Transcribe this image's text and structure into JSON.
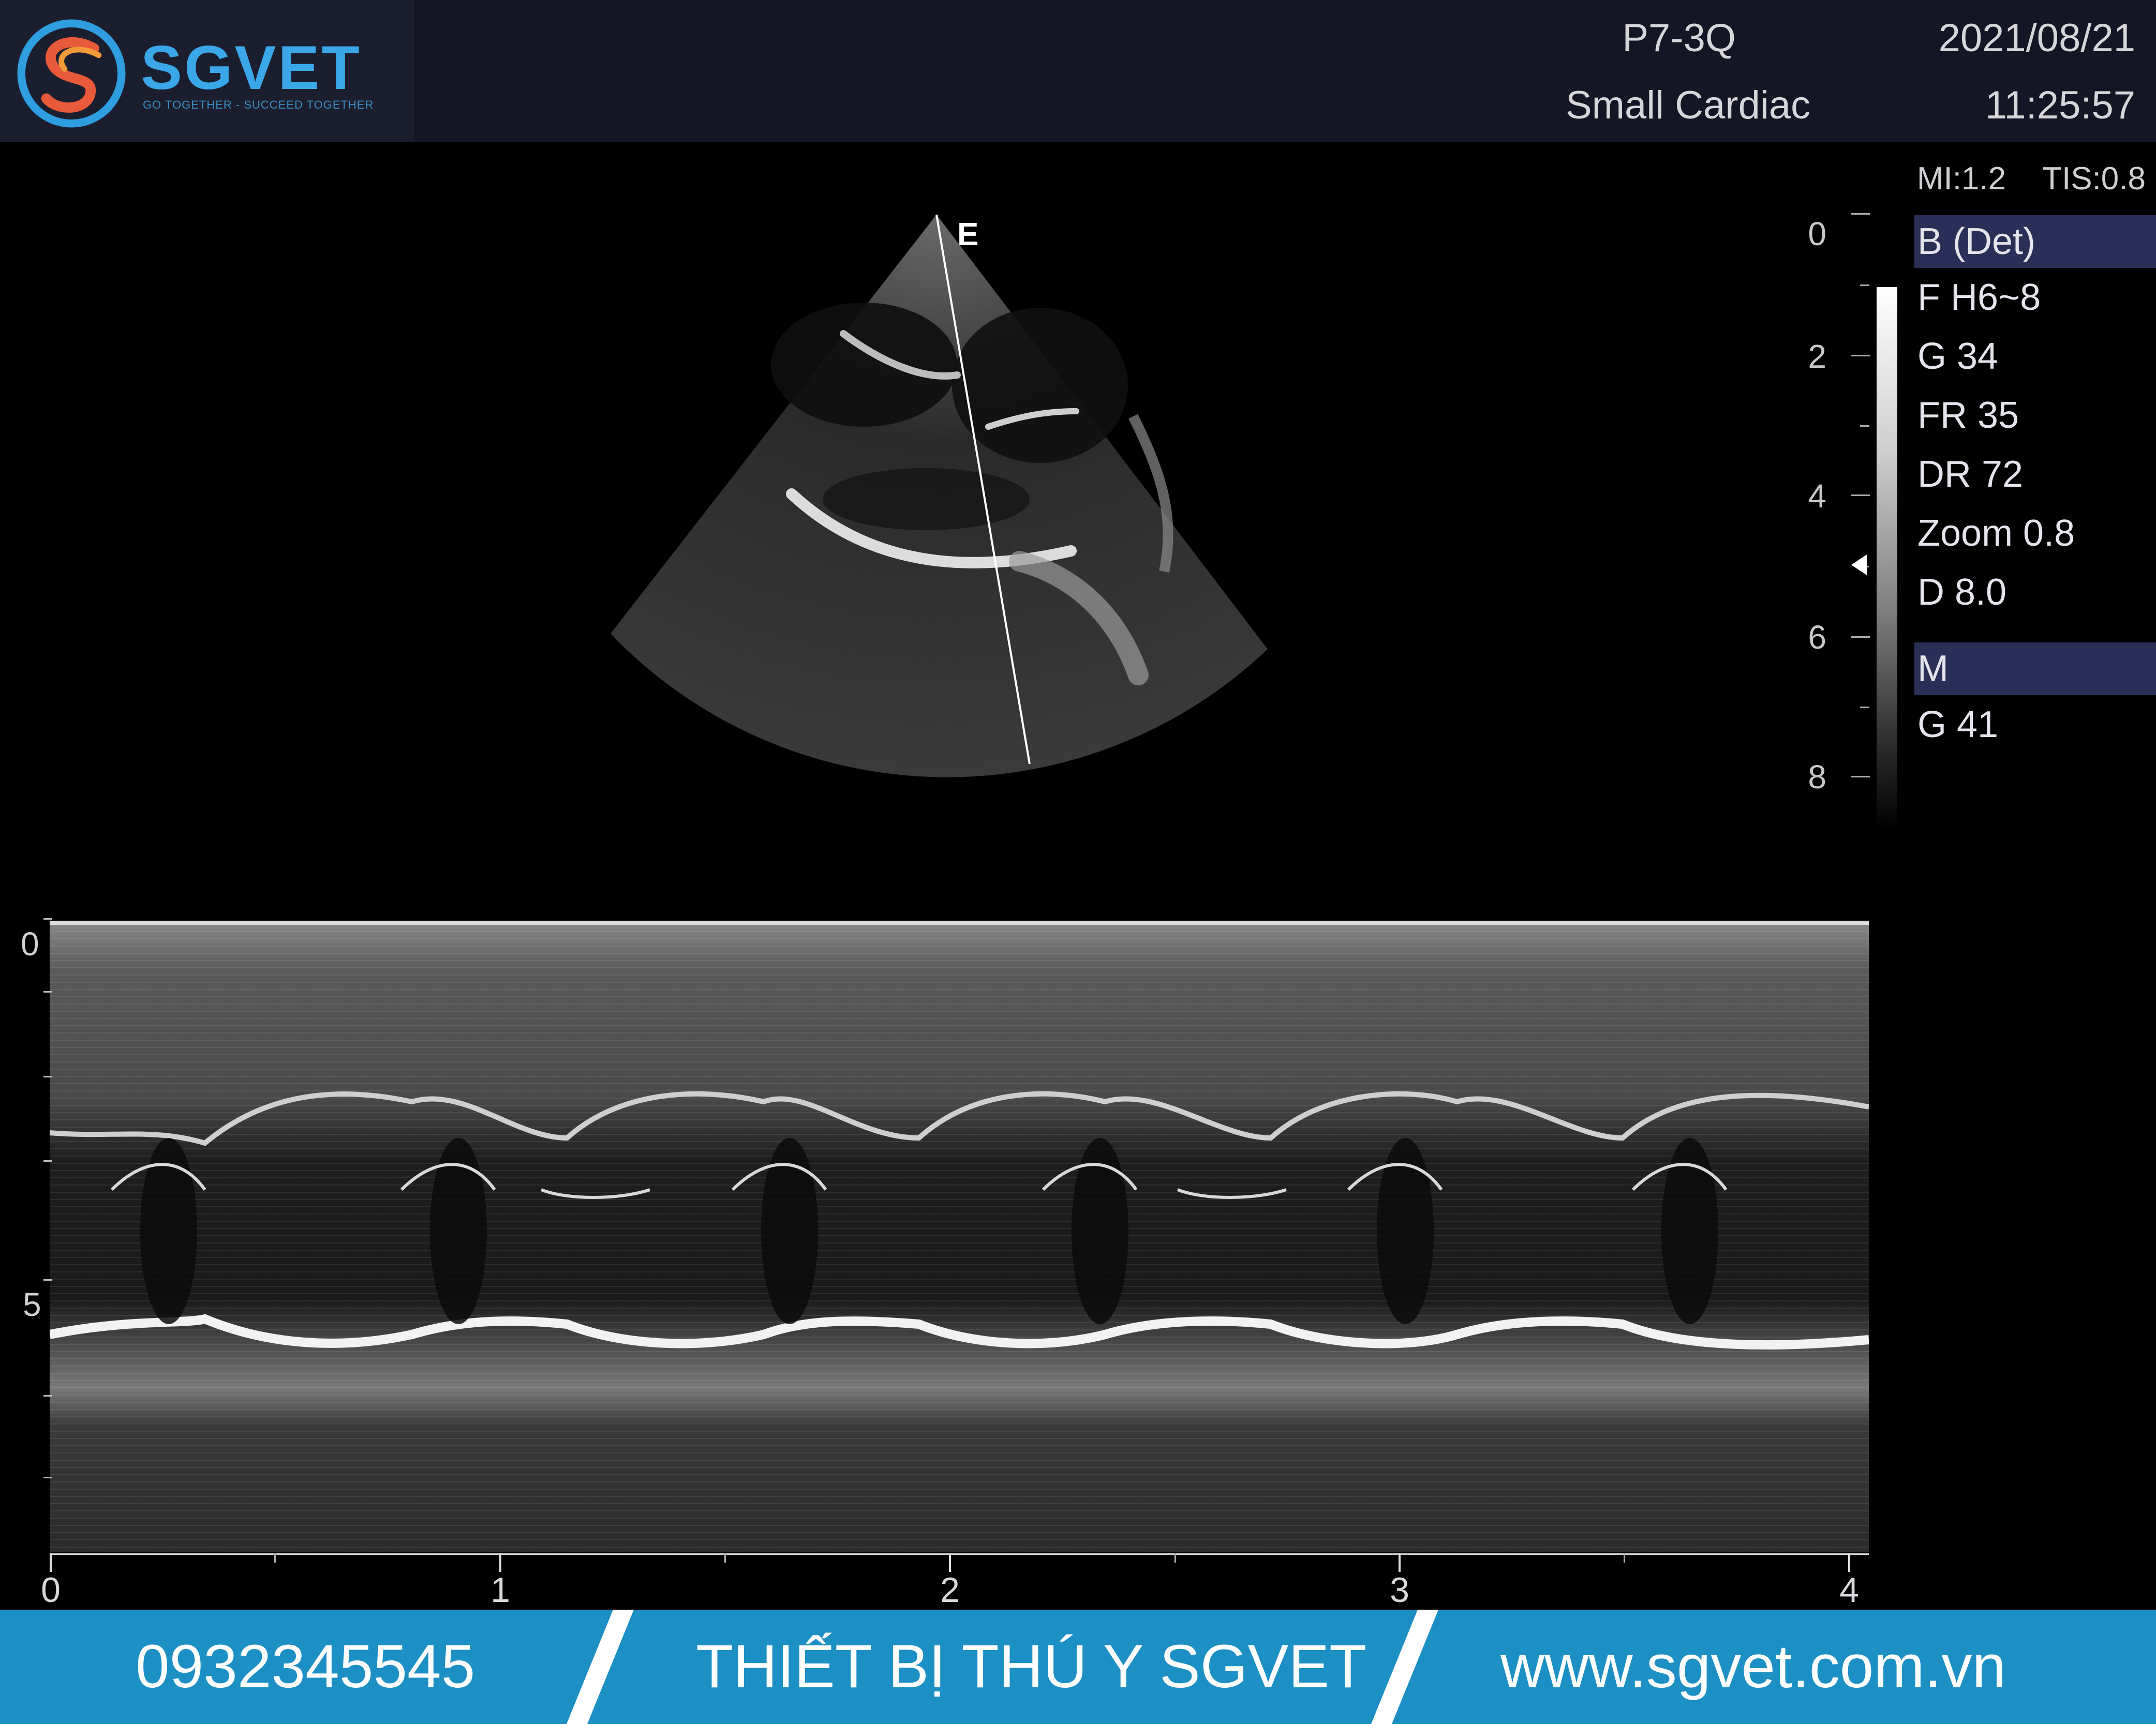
{
  "brand": {
    "name": "SGVET",
    "tagline": "GO TOGETHER - SUCCEED TOGETHER",
    "color": "#3aa8e8"
  },
  "header": {
    "probe": "P7-3Q",
    "preset": "Small Cardiac",
    "date": "2021/08/21",
    "time": "11:25:57"
  },
  "safety": {
    "mi": "MI:1.2",
    "tis": "TIS:0.8"
  },
  "b_mode": {
    "title": "B (Det)",
    "params": [
      "F H6~8",
      "G 34",
      "FR 35",
      "DR 72",
      "Zoom 0.8",
      "D 8.0"
    ],
    "depth_scale": [
      "0",
      "2",
      "4",
      "6",
      "8"
    ],
    "cursor_label": "E"
  },
  "m_mode": {
    "title": "M",
    "params": [
      "G 41"
    ],
    "depth_scale": [
      "0",
      "5"
    ],
    "time_axis": [
      "0",
      "1",
      "2",
      "3",
      "4"
    ]
  },
  "footer": {
    "phone": "0932345545",
    "company": "THIẾT BỊ THÚ Y SGVET",
    "website": "www.sgvet.com.vn",
    "color": "#1c8fc4"
  }
}
